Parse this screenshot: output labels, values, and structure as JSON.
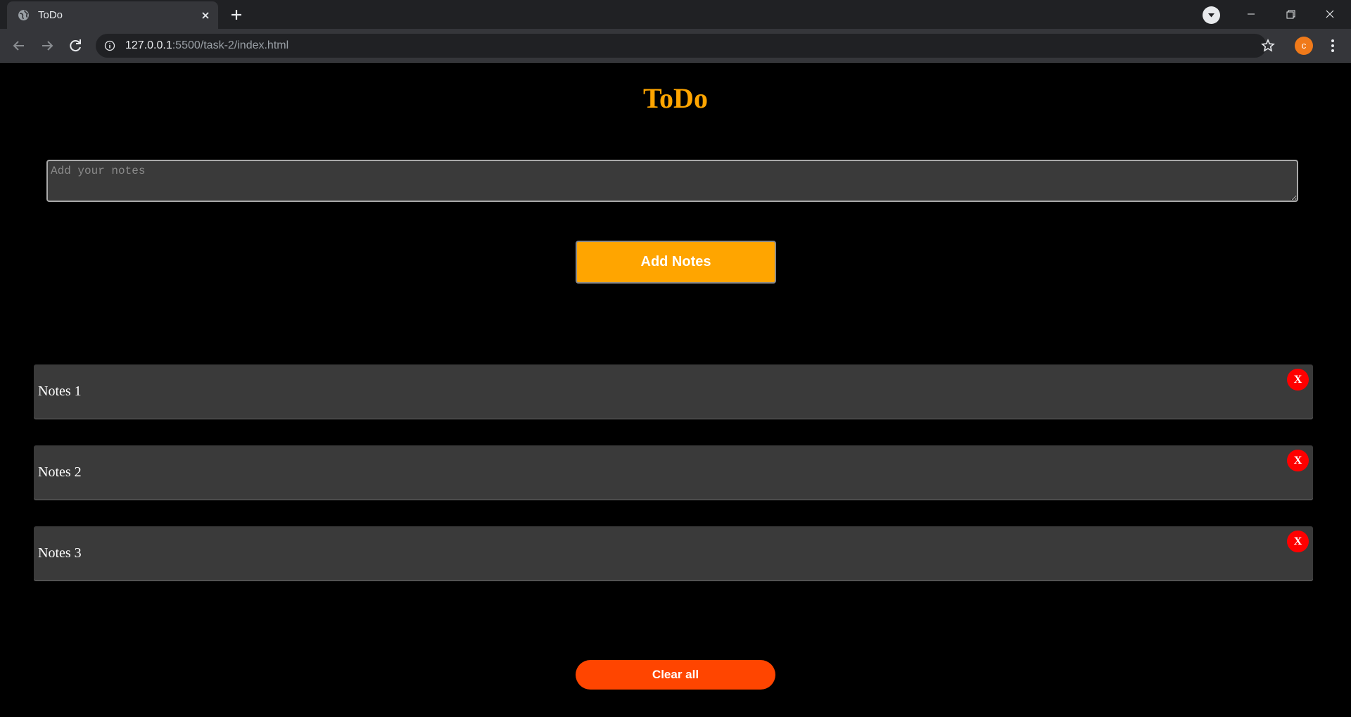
{
  "browser": {
    "tab_title": "ToDo",
    "url_host": "127.0.0.1",
    "url_path": ":5500/task-2/index.html",
    "profile_initial": "c"
  },
  "app": {
    "title": "ToDo",
    "input_placeholder": "Add your notes",
    "input_value": "",
    "add_button_label": "Add Notes",
    "clear_button_label": "Clear all",
    "notes": [
      {
        "text": "Notes 1",
        "delete_label": "X"
      },
      {
        "text": "Notes 2",
        "delete_label": "X"
      },
      {
        "text": "Notes 3",
        "delete_label": "X"
      }
    ]
  },
  "colors": {
    "title": "#ffa500",
    "add_button": "#ffa500",
    "clear_button": "#ff4500",
    "delete_button": "#ff0000",
    "note_background": "#3a3a3a",
    "page_background": "#000000"
  },
  "icons": [
    "globe-icon",
    "close-icon",
    "plus-icon",
    "chevron-down-icon",
    "minimize-icon",
    "maximize-icon",
    "window-close-icon",
    "back-arrow-icon",
    "forward-arrow-icon",
    "reload-icon",
    "info-icon",
    "star-icon",
    "kebab-menu-icon"
  ]
}
